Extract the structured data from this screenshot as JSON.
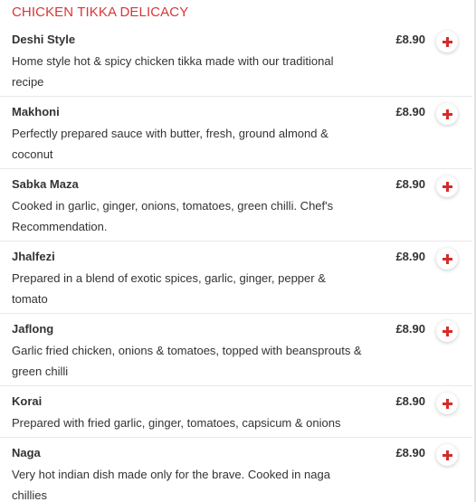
{
  "section": {
    "title": "CHICKEN TIKKA DELICACY"
  },
  "colors": {
    "accent": "#d93636",
    "plus": "#d92a2a",
    "text": "#333333",
    "divider": "#e9e9e9"
  },
  "icons": {
    "add": "plus-icon"
  },
  "items": [
    {
      "name": "Deshi Style",
      "price": "£8.90",
      "description": "Home style hot & spicy chicken tikka made with our traditional recipe"
    },
    {
      "name": "Makhoni",
      "price": "£8.90",
      "description": "Perfectly prepared sauce with butter, fresh, ground almond & coconut"
    },
    {
      "name": "Sabka Maza",
      "price": "£8.90",
      "description": "Cooked in garlic, ginger, onions, tomatoes, green chilli. Chef's Recommendation."
    },
    {
      "name": "Jhalfezi",
      "price": "£8.90",
      "description": "Prepared in a blend of exotic spices, garlic, ginger, pepper & tomato"
    },
    {
      "name": "Jaflong",
      "price": "£8.90",
      "description": "Garlic fried chicken, onions & tomatoes, topped with beansprouts & green chilli"
    },
    {
      "name": "Korai",
      "price": "£8.90",
      "description": "Prepared with fried garlic, ginger, tomatoes, capsicum & onions"
    },
    {
      "name": "Naga",
      "price": "£8.90",
      "description": "Very hot indian dish made only for the brave. Cooked in naga chillies"
    }
  ]
}
